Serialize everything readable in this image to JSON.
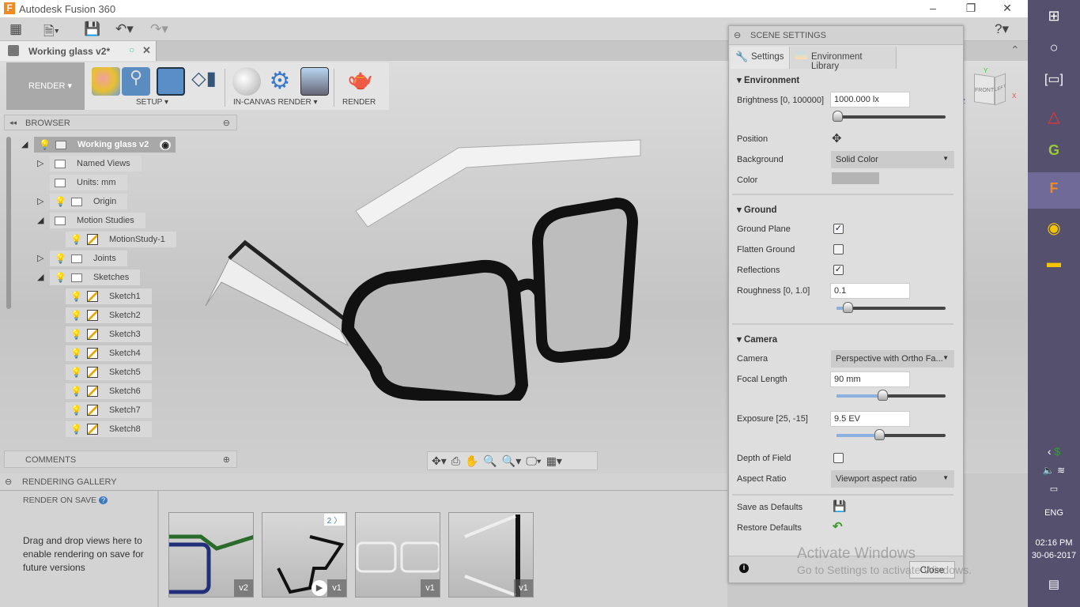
{
  "window": {
    "title": "Autodesk Fusion 360",
    "minimize": "–",
    "maximize": "❐",
    "close": "✕"
  },
  "quick_access": {
    "icons": [
      "grid-icon",
      "file-icon",
      "save-icon",
      "undo-icon",
      "redo-icon",
      "help-icon"
    ]
  },
  "document_tab": {
    "label": "Working glass v2*"
  },
  "ribbon": {
    "workspace": "RENDER",
    "groups": [
      {
        "label": "SETUP"
      },
      {
        "label": "IN-CANVAS RENDER"
      },
      {
        "label": "RENDER"
      }
    ]
  },
  "browser": {
    "title": "BROWSER",
    "items": [
      {
        "label": "Working glass v2",
        "level": 0,
        "expander": "open",
        "bulb": "on",
        "icon": "component"
      },
      {
        "label": "Named Views",
        "level": 1,
        "expander": "closed",
        "icon": "folder"
      },
      {
        "label": "Units: mm",
        "level": 1,
        "icon": "document"
      },
      {
        "label": "Origin",
        "level": 1,
        "expander": "closed",
        "bulb": "off",
        "icon": "folder"
      },
      {
        "label": "Motion Studies",
        "level": 1,
        "expander": "open",
        "icon": "folder"
      },
      {
        "label": "MotionStudy-1",
        "level": 2,
        "bulb": "on",
        "icon": "motion"
      },
      {
        "label": "Joints",
        "level": 1,
        "expander": "closed",
        "bulb": "off",
        "icon": "folder"
      },
      {
        "label": "Sketches",
        "level": 1,
        "expander": "open",
        "bulb": "on",
        "icon": "folder"
      },
      {
        "label": "Sketch1",
        "level": 2,
        "bulb": "off",
        "icon": "sketch"
      },
      {
        "label": "Sketch2",
        "level": 2,
        "bulb": "off",
        "icon": "sketch"
      },
      {
        "label": "Sketch3",
        "level": 2,
        "bulb": "off",
        "icon": "sketch"
      },
      {
        "label": "Sketch4",
        "level": 2,
        "bulb": "off",
        "icon": "sketch"
      },
      {
        "label": "Sketch5",
        "level": 2,
        "bulb": "off",
        "icon": "sketch"
      },
      {
        "label": "Sketch6",
        "level": 2,
        "bulb": "off",
        "icon": "sketch"
      },
      {
        "label": "Sketch7",
        "level": 2,
        "bulb": "off",
        "icon": "sketch"
      },
      {
        "label": "Sketch8",
        "level": 2,
        "bulb": "off",
        "icon": "sketch"
      }
    ]
  },
  "comments": {
    "title": "COMMENTS"
  },
  "viewcube": {
    "front": "FRONT",
    "left": "LEFT",
    "x": "X",
    "y": "Y",
    "z": "Z"
  },
  "gallery": {
    "title": "RENDERING GALLERY",
    "render_on_save": "RENDER ON SAVE",
    "hint": "Drag and drop views here to enable rendering on save for future versions",
    "thumbnails": [
      {
        "version": "v2"
      },
      {
        "version": "v1",
        "count": "2 〉",
        "video": true
      },
      {
        "version": "v1"
      },
      {
        "version": "v1"
      }
    ]
  },
  "scene_settings": {
    "title": "SCENE SETTINGS",
    "tabs": [
      "Settings",
      "Environment Library"
    ],
    "environment": {
      "title": "Environment",
      "brightness_label": "Brightness [0, 100000]",
      "brightness": "1000.000 lx",
      "brightness_fraction": 0.01,
      "position_label": "Position",
      "background_label": "Background",
      "background": "Solid Color",
      "color_label": "Color",
      "color": "#b4b4b4"
    },
    "ground": {
      "title": "Ground",
      "ground_plane_label": "Ground Plane",
      "ground_plane": true,
      "flatten_label": "Flatten Ground",
      "flatten": false,
      "reflections_label": "Reflections",
      "reflections": true,
      "roughness_label": "Roughness [0, 1.0]",
      "roughness": "0.1",
      "roughness_fraction": 0.1
    },
    "camera": {
      "title": "Camera",
      "camera_label": "Camera",
      "camera": "Perspective with Ortho Fa...",
      "focal_label": "Focal Length",
      "focal": "90 mm",
      "focal_fraction": 0.42,
      "exposure_label": "Exposure [25, -15]",
      "exposure": "9.5 EV",
      "exposure_fraction": 0.39,
      "dof_label": "Depth of Field",
      "dof": false,
      "aspect_label": "Aspect Ratio",
      "aspect": "Viewport aspect ratio"
    },
    "save_defaults": "Save as Defaults",
    "restore_defaults": "Restore Defaults",
    "close": "Close"
  },
  "watermark": {
    "line1": "Activate Windows",
    "line2": "Go to Settings to activate Windows."
  },
  "taskbar": {
    "language": "ENG",
    "time": "02:16 PM",
    "date": "30-06-2017"
  }
}
